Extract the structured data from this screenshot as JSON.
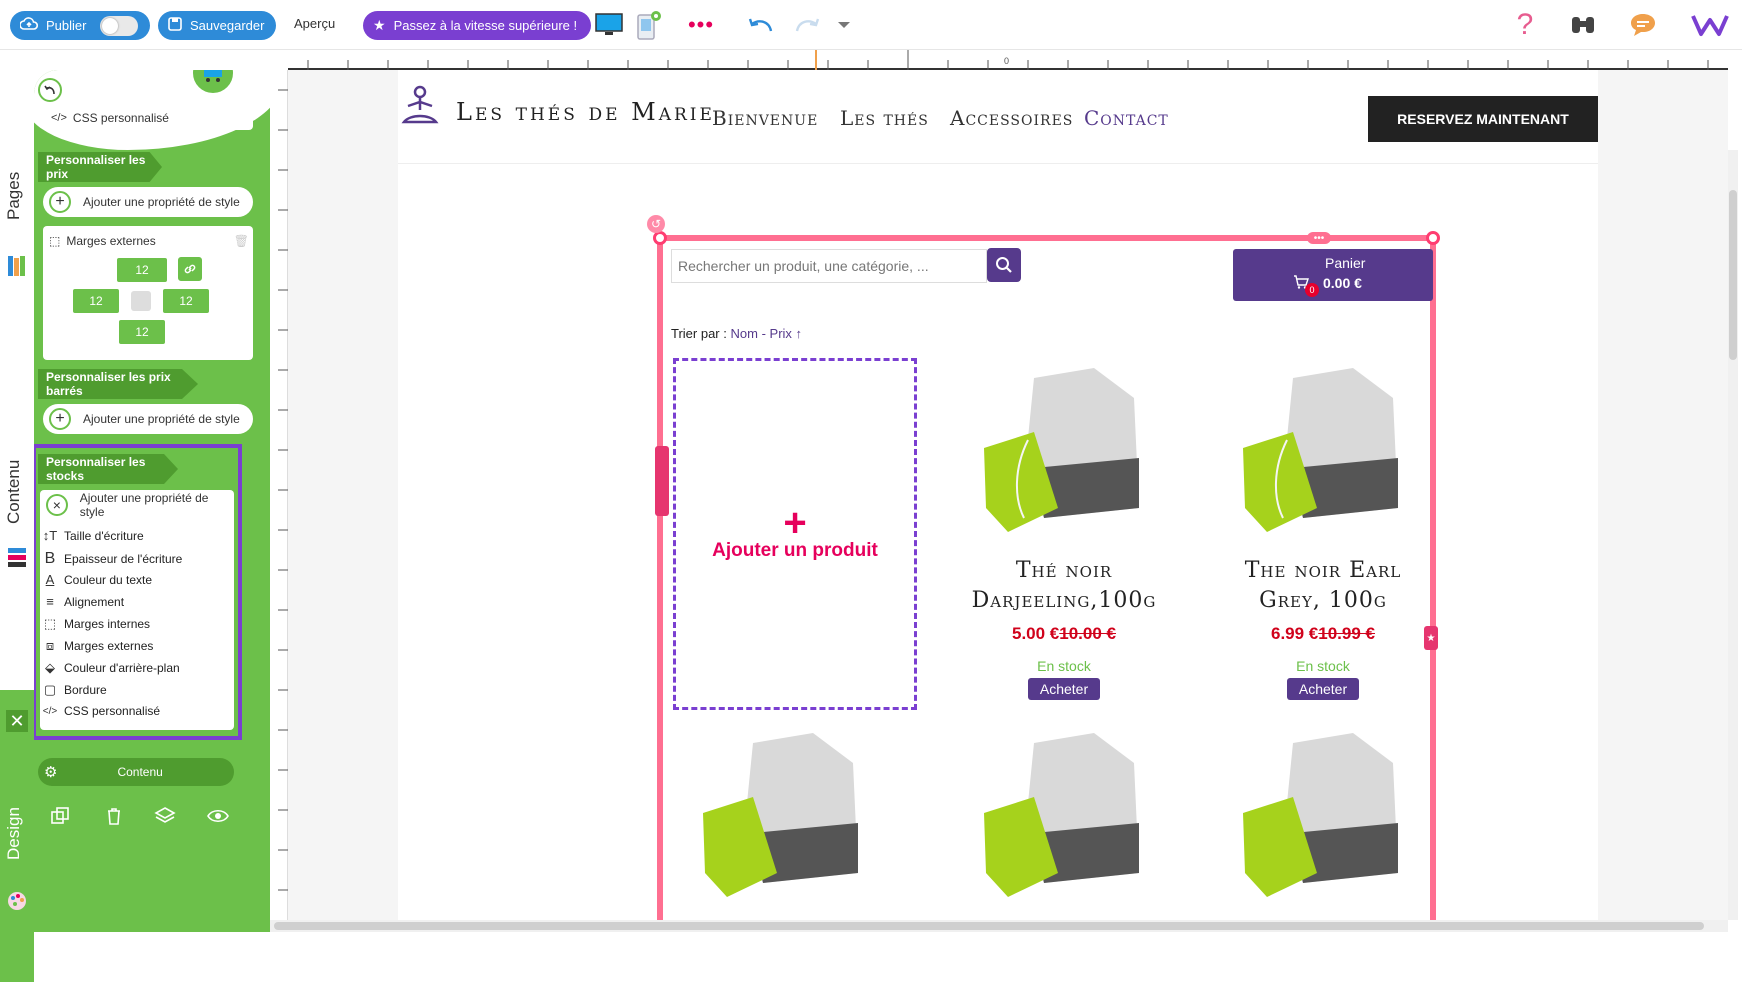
{
  "toolbar": {
    "publish_label": "Publier",
    "save_label": "Sauvegarder",
    "preview_label": "Aperçu",
    "upgrade_label": "Passez à la vitesse supérieure !"
  },
  "sidetabs": {
    "pages": "Pages",
    "content": "Contenu",
    "design": "Design"
  },
  "panel": {
    "css_top": "CSS personnalisé",
    "sections": {
      "prices": "Personnaliser les prix",
      "struck_prices": "Personnaliser les prix barrés",
      "stocks": "Personnaliser les stocks"
    },
    "add_style": "Ajouter une propriété de style",
    "margins_label": "Marges externes",
    "margin_values": {
      "top": "12",
      "left": "12",
      "right": "12",
      "bottom": "12"
    },
    "style_options": [
      "Taille d'écriture",
      "Epaisseur de l'écriture",
      "Couleur du texte",
      "Alignement",
      "Marges internes",
      "Marges externes",
      "Couleur d'arrière-plan",
      "Bordure",
      "CSS personnalisé"
    ],
    "footer_label": "Contenu"
  },
  "ruler": {
    "zero": "0"
  },
  "site": {
    "brand": "Les thés de Marie",
    "nav": [
      "Bienvenue",
      "Les thés",
      "Accessoires",
      "Contact"
    ],
    "reserve": "RESERVEZ MAINTENANT",
    "search_placeholder": "Rechercher un produit, une catégorie, ...",
    "cart": {
      "label": "Panier",
      "count": "0",
      "total": "0.00 €"
    },
    "sort": {
      "prefix": "Trier par :",
      "name": "Nom",
      "sep": "-",
      "price": "Prix ↑"
    },
    "add_product": "Ajouter un produit",
    "products": [
      {
        "title": "Thé noir Darjeeling,100g",
        "price": "5.00 €",
        "old_price": "10.00 €",
        "stock": "En stock",
        "buy": "Acheter"
      },
      {
        "title": "The noir Earl Grey, 100g",
        "price": "6.99 €",
        "old_price": "10.99 €",
        "stock": "En stock",
        "buy": "Acheter"
      }
    ]
  },
  "colors": {
    "panel_green": "#6cc04a",
    "accent_purple": "#7a3fd1",
    "selection_pink": "#ff6f91",
    "site_purple": "#563a8c",
    "price_red": "#d0021b"
  }
}
